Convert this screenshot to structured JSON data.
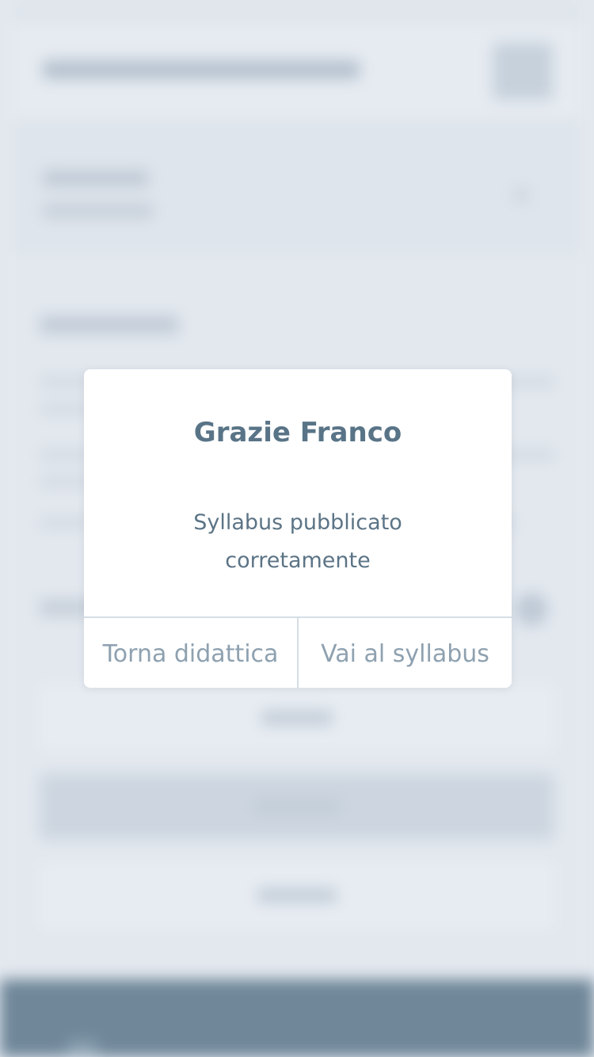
{
  "dialog": {
    "title": "Grazie Franco",
    "message": "Syllabus pubblicato corretamente",
    "actions": {
      "back_label": "Torna didattica",
      "go_label": "Vai al syllabus"
    }
  },
  "colors": {
    "title": "#597487",
    "message": "#5c7486",
    "action_text": "#8ea1b0",
    "footer": "#6f8799",
    "backdrop": "#e3e8ef"
  }
}
